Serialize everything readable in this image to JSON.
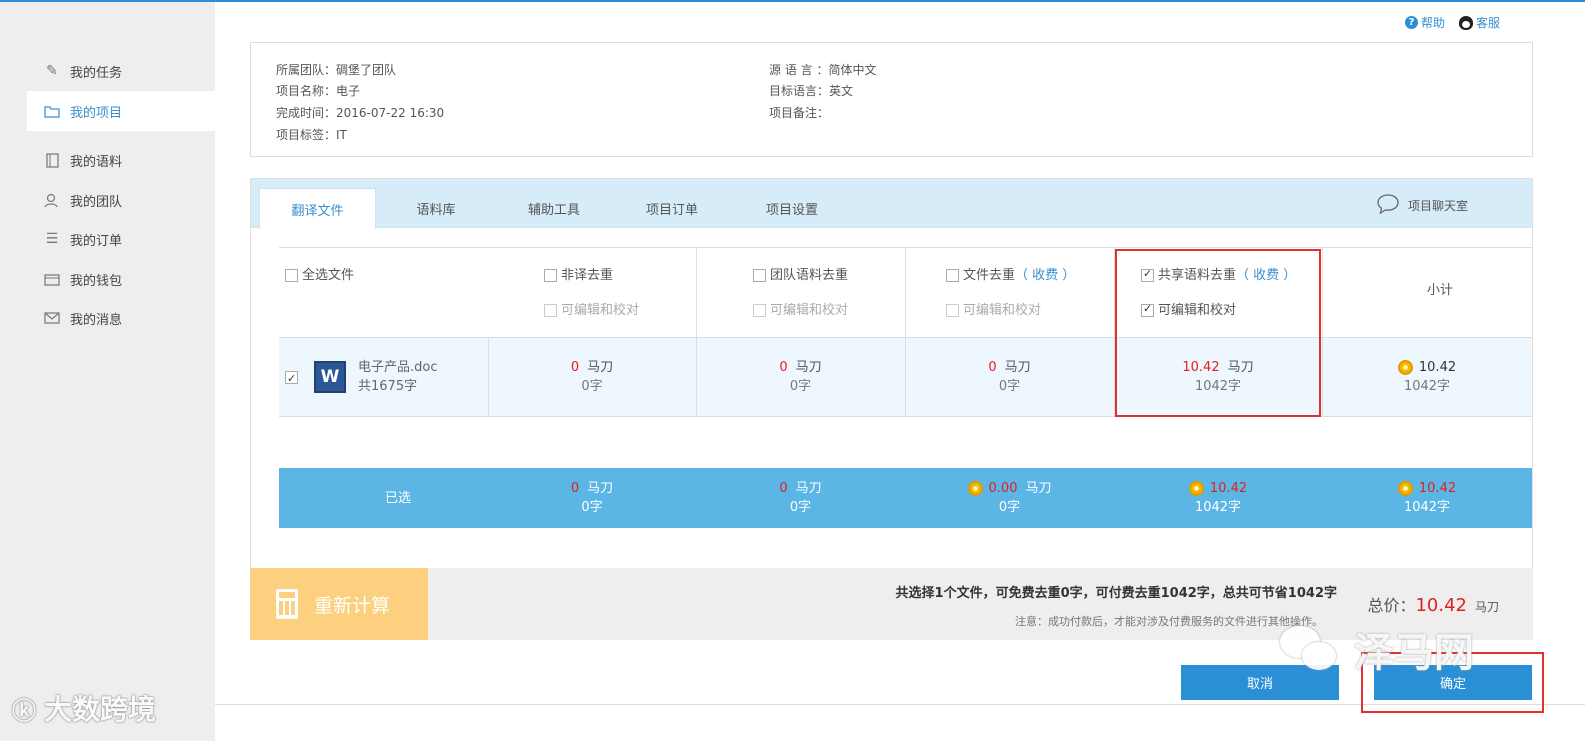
{
  "header": {
    "help": "帮助",
    "service": "客服"
  },
  "sidebar": {
    "items": [
      {
        "label": "我的任务",
        "icon": "edit-icon"
      },
      {
        "label": "我的项目",
        "icon": "folder-icon",
        "active": true
      },
      {
        "label": "我的语料",
        "icon": "notebook-icon"
      },
      {
        "label": "我的团队",
        "icon": "team-icon"
      },
      {
        "label": "我的订单",
        "icon": "list-icon"
      },
      {
        "label": "我的钱包",
        "icon": "wallet-icon"
      },
      {
        "label": "我的消息",
        "icon": "mail-icon"
      }
    ]
  },
  "project_info": {
    "team": "所属团队：碉堡了团队",
    "name": "项目名称：电子",
    "finish_time": "完成时间：2016-07-22 16:30",
    "tag": "项目标签：IT",
    "source_lang": "源 语 言 ：简体中文",
    "target_lang": "目标语言：英文",
    "remark": "项目备注："
  },
  "tabs": [
    "翻译文件",
    "语料库",
    "辅助工具",
    "项目订单",
    "项目设置"
  ],
  "chat_room": "项目聊天室",
  "columns": {
    "select_all": "全选文件",
    "col1": "非译去重",
    "col2": "团队语料去重",
    "col3": "文件去重",
    "col4": "共享语料去重",
    "fee": "（ 收费 ）",
    "editable": "可编辑和校对",
    "subtotal": "小计"
  },
  "file": {
    "name": "电子产品.doc",
    "count": "共1675字",
    "cells": [
      {
        "amount": "0",
        "unit": "马刀",
        "words": "0字"
      },
      {
        "amount": "0",
        "unit": "马刀",
        "words": "0字"
      },
      {
        "amount": "0",
        "unit": "马刀",
        "words": "0字"
      },
      {
        "amount": "10.42",
        "unit": "马刀",
        "words": "1042字"
      }
    ],
    "subtotal_amount": "10.42",
    "subtotal_words": "1042字"
  },
  "selected": {
    "label": "已选",
    "cells": [
      {
        "amount": "0",
        "unit": "马刀",
        "words": "0字"
      },
      {
        "amount": "0",
        "unit": "马刀",
        "words": "0字"
      },
      {
        "amount": "0.00",
        "unit": "马刀",
        "words": "0字"
      },
      {
        "amount": "10.42",
        "words": "1042字"
      }
    ],
    "subtotal_amount": "10.42",
    "subtotal_words": "1042字"
  },
  "bottom": {
    "recalc": "重新计算",
    "summary": "共选择1个文件，可免费去重0字，可付费去重1042字，总共可节省1042字",
    "note": "注意：成功付款后，才能对涉及付费服务的文件进行其他操作。",
    "total_label": "总价：",
    "total_amount": "10.42",
    "total_unit": "马刀"
  },
  "buttons": {
    "cancel": "取消",
    "confirm": "确定"
  },
  "watermarks": {
    "left": "大数跨境",
    "right": "泽马网"
  }
}
